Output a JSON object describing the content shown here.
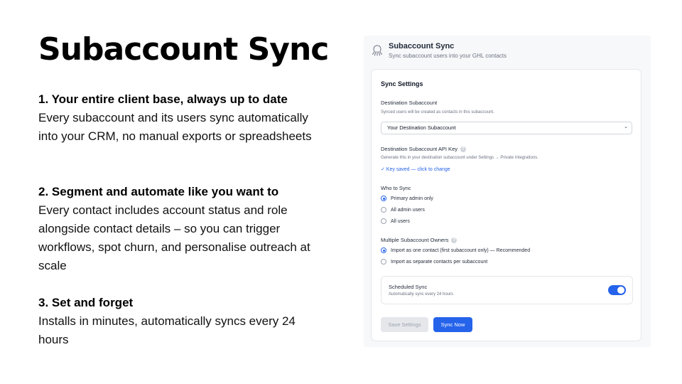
{
  "slide": {
    "title": "Subaccount Sync",
    "features": [
      {
        "heading": "1. Your entire client base, always up to date",
        "body": "Every subaccount and its users sync automatically into your CRM, no manual exports or spreadsheets"
      },
      {
        "heading": "2. Segment and automate like you want to",
        "body": "Every contact includes account status and role alongside contact details – so you can trigger workflows, spot churn, and personalise outreach at scale"
      },
      {
        "heading": "3. Set and forget",
        "body": "Installs in minutes, automatically syncs every 24 hours"
      }
    ]
  },
  "app": {
    "title": "Subaccount Sync",
    "subtitle": "Sync subaccount users into your GHL contacts",
    "logo_icon": "octopus-icon",
    "settings": {
      "section_title": "Sync Settings",
      "destination": {
        "label": "Destination Subaccount",
        "hint": "Synced users will be created as contacts in this subaccount.",
        "selected": "Your Destination Subaccount"
      },
      "api_key": {
        "label": "Destination Subaccount API Key",
        "hint": "Generate this in your destination subaccount under Settings → Private Integrations.",
        "status": "✓ Key saved — click to change"
      },
      "who_to_sync": {
        "label": "Who to Sync",
        "options": [
          {
            "label": "Primary admin only",
            "selected": true
          },
          {
            "label": "All admin users",
            "selected": false
          },
          {
            "label": "All users",
            "selected": false
          }
        ]
      },
      "owners": {
        "label": "Multiple Subaccount Owners",
        "options": [
          {
            "label": "Import as one contact (first subaccount only) — Recommended",
            "selected": true
          },
          {
            "label": "Import as separate contacts per subaccount",
            "selected": false
          }
        ]
      },
      "scheduled": {
        "label": "Scheduled Sync",
        "hint": "Automatically sync every 24 hours",
        "enabled": true
      },
      "buttons": {
        "save": "Save Settings",
        "sync": "Sync Now"
      },
      "colors": {
        "accent": "#2563eb",
        "disabled": "#e5e7eb"
      }
    }
  }
}
